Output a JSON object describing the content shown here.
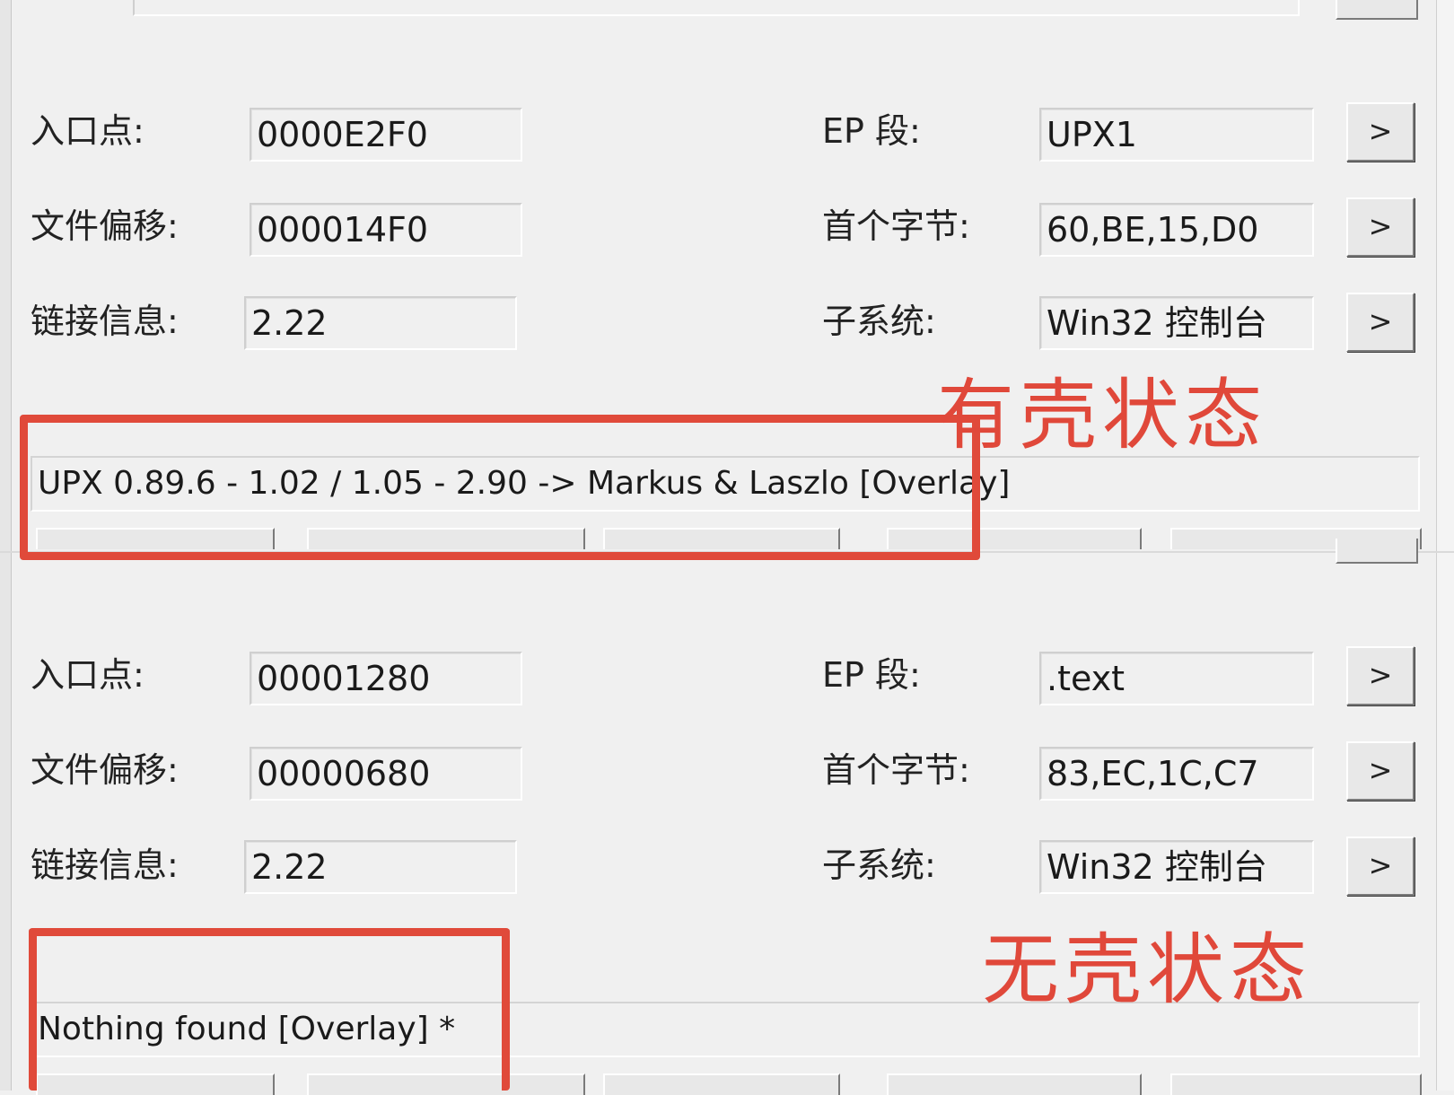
{
  "panel_top": {
    "entry_point": {
      "label": "入口点:",
      "value": "0000E2F0"
    },
    "file_offset": {
      "label": "文件偏移:",
      "value": "000014F0"
    },
    "link_info": {
      "label": "链接信息:",
      "value": "2.22"
    },
    "ep_section": {
      "label": "EP 段:",
      "value": "UPX1",
      "button": ">"
    },
    "first_bytes": {
      "label": "首个字节:",
      "value": "60,BE,15,D0",
      "button": ">"
    },
    "subsystem": {
      "label": "子系统:",
      "value": "Win32 控制台",
      "button": ">"
    },
    "detection": "UPX 0.89.6 - 1.02 / 1.05 - 2.90 -> Markus & Laszlo [Overlay]"
  },
  "panel_bottom": {
    "entry_point": {
      "label": "入口点:",
      "value": "00001280"
    },
    "file_offset": {
      "label": "文件偏移:",
      "value": "00000680"
    },
    "link_info": {
      "label": "链接信息:",
      "value": "2.22"
    },
    "ep_section": {
      "label": "EP 段:",
      "value": ".text",
      "button": ">"
    },
    "first_bytes": {
      "label": "首个字节:",
      "value": "83,EC,1C,C7",
      "button": ">"
    },
    "subsystem": {
      "label": "子系统:",
      "value": "Win32 控制台",
      "button": ">"
    },
    "detection": "Nothing found [Overlay] *"
  },
  "annotations": {
    "packed": "有壳状态",
    "unpacked": "无壳状态",
    "color": "#e04a3a"
  }
}
